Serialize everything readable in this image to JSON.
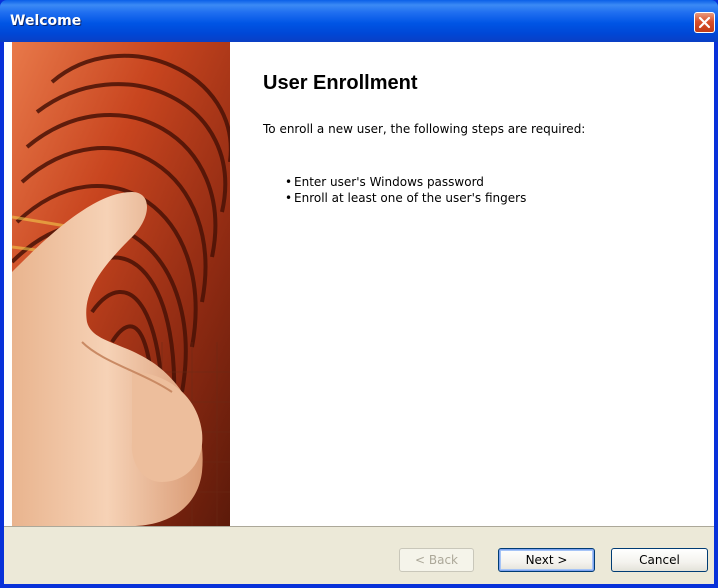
{
  "window": {
    "title": "Welcome",
    "close_icon": "close-icon"
  },
  "page": {
    "heading": "User Enrollment",
    "intro": "To enroll a new user, the following steps are required:",
    "steps": [
      "Enter user's Windows password",
      "Enroll at least one of the user's fingers"
    ],
    "bullet": "•"
  },
  "buttons": {
    "back": "< Back",
    "next": "Next >",
    "cancel": "Cancel"
  },
  "colors": {
    "titlebar": "#0055E5",
    "close_button": "#D9502B",
    "dialog_bg": "#ECE9D8",
    "image_accent": "#C8451F"
  }
}
